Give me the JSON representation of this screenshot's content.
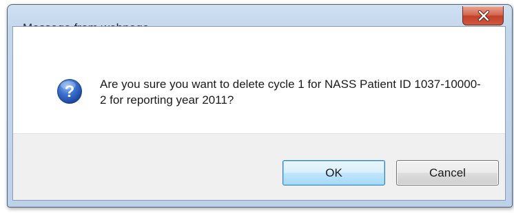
{
  "dialog": {
    "title": "Message from webpage",
    "message": "Are you sure you want to delete cycle 1 for NASS Patient ID 1037-10000-2 for reporting year 2011?",
    "icon": "question-icon",
    "buttons": {
      "ok_label": "OK",
      "cancel_label": "Cancel"
    },
    "close_icon": "close-icon"
  },
  "colors": {
    "titlebar": "#c2d6ec",
    "close_button": "#c2402a",
    "footer": "#f0f0f0",
    "ok_button_border": "#3c7fb1",
    "question_icon": "#2a5bb8"
  }
}
